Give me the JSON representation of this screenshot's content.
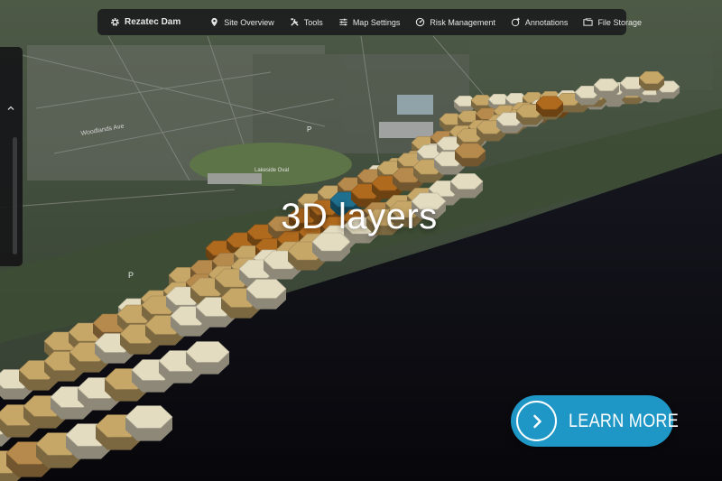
{
  "toolbar": {
    "site_name": "Rezatec Dam",
    "items": [
      {
        "label": "Site Overview",
        "icon": "location-pin-icon"
      },
      {
        "label": "Tools",
        "icon": "tools-icon"
      },
      {
        "label": "Map Settings",
        "icon": "sliders-icon"
      },
      {
        "label": "Risk Management",
        "icon": "gauge-icon"
      },
      {
        "label": "Annotations",
        "icon": "annotation-add-icon"
      },
      {
        "label": "File Storage",
        "icon": "folder-icon"
      }
    ]
  },
  "map": {
    "street_label": "Woodlands Ave",
    "oval_label": "Lakeside Oval",
    "parking_label": "P",
    "hex_colors": [
      "#e3dcc1",
      "#c7a768",
      "#b68a4c",
      "#b06a1e",
      "#1f6f8e"
    ]
  },
  "overlay": {
    "title": "3D layers"
  },
  "cta": {
    "label": "LEARN MORE",
    "color": "#1e97c6"
  }
}
